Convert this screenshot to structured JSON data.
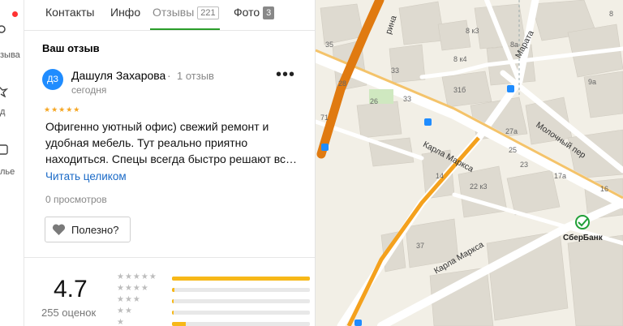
{
  "sidebar": {
    "items": [
      {
        "label": "зыва",
        "icon": "pin-icon"
      },
      {
        "label": "д",
        "icon": "star-icon"
      },
      {
        "label": "лье",
        "icon": "bag-icon"
      }
    ]
  },
  "tabs": [
    {
      "label": "Контакты",
      "badge": ""
    },
    {
      "label": "Инфо",
      "badge": ""
    },
    {
      "label": "Отзывы",
      "badge": "221"
    },
    {
      "label": "Фото",
      "badge": "3"
    }
  ],
  "review": {
    "title": "Ваш отзыв",
    "avatar_initials": "ДЗ",
    "author": "Дашуля Захарова",
    "separator": "·",
    "author_reviews": "1 отзыв",
    "date": "сегодня",
    "stars": "★★★★★",
    "rating": 5,
    "text": "Офигенно уютный офис) свежий ремонт и удобная мебель. Тут реально приятно находиться. Спецы всегда быстро решают вс…",
    "read_more": "Читать целиком",
    "views": "0 просмотров",
    "useful_label": "Полезно?",
    "more_label": "•••"
  },
  "summary": {
    "score": "4.7",
    "count": "255 оценок",
    "rows": [
      {
        "stars": "★★★★★",
        "fraction": 1.0
      },
      {
        "stars": "★★★★",
        "fraction": 0.02
      },
      {
        "stars": "★★★",
        "fraction": 0.01
      },
      {
        "stars": "★★",
        "fraction": 0.01
      },
      {
        "stars": "★",
        "fraction": 0.1
      }
    ]
  },
  "map": {
    "streets": {
      "karla_marksa_1": "Карла Маркса",
      "karla_marksa_2": "Карла Маркса",
      "molochny": "Молочный пер",
      "marata": "Марата",
      "partial_rina": "рина"
    },
    "poi": "СберБанк",
    "house_numbers": [
      "35",
      "8 к3",
      "8а",
      "8 к4",
      "28",
      "33",
      "26",
      "31б",
      "9а",
      "33",
      "71",
      "27а",
      "25",
      "14",
      "23",
      "17а",
      "22 к3",
      "16",
      "37",
      "8"
    ],
    "colors": {
      "road_major": "#f4a11d",
      "road_orange_center": "#e07a10",
      "building": "#dedad0",
      "land": "#f2efe6",
      "road_white": "#ffffff",
      "accent_green": "#2a9d2a",
      "link_blue": "#1a6ac7",
      "star_yellow": "#f7b818"
    }
  }
}
